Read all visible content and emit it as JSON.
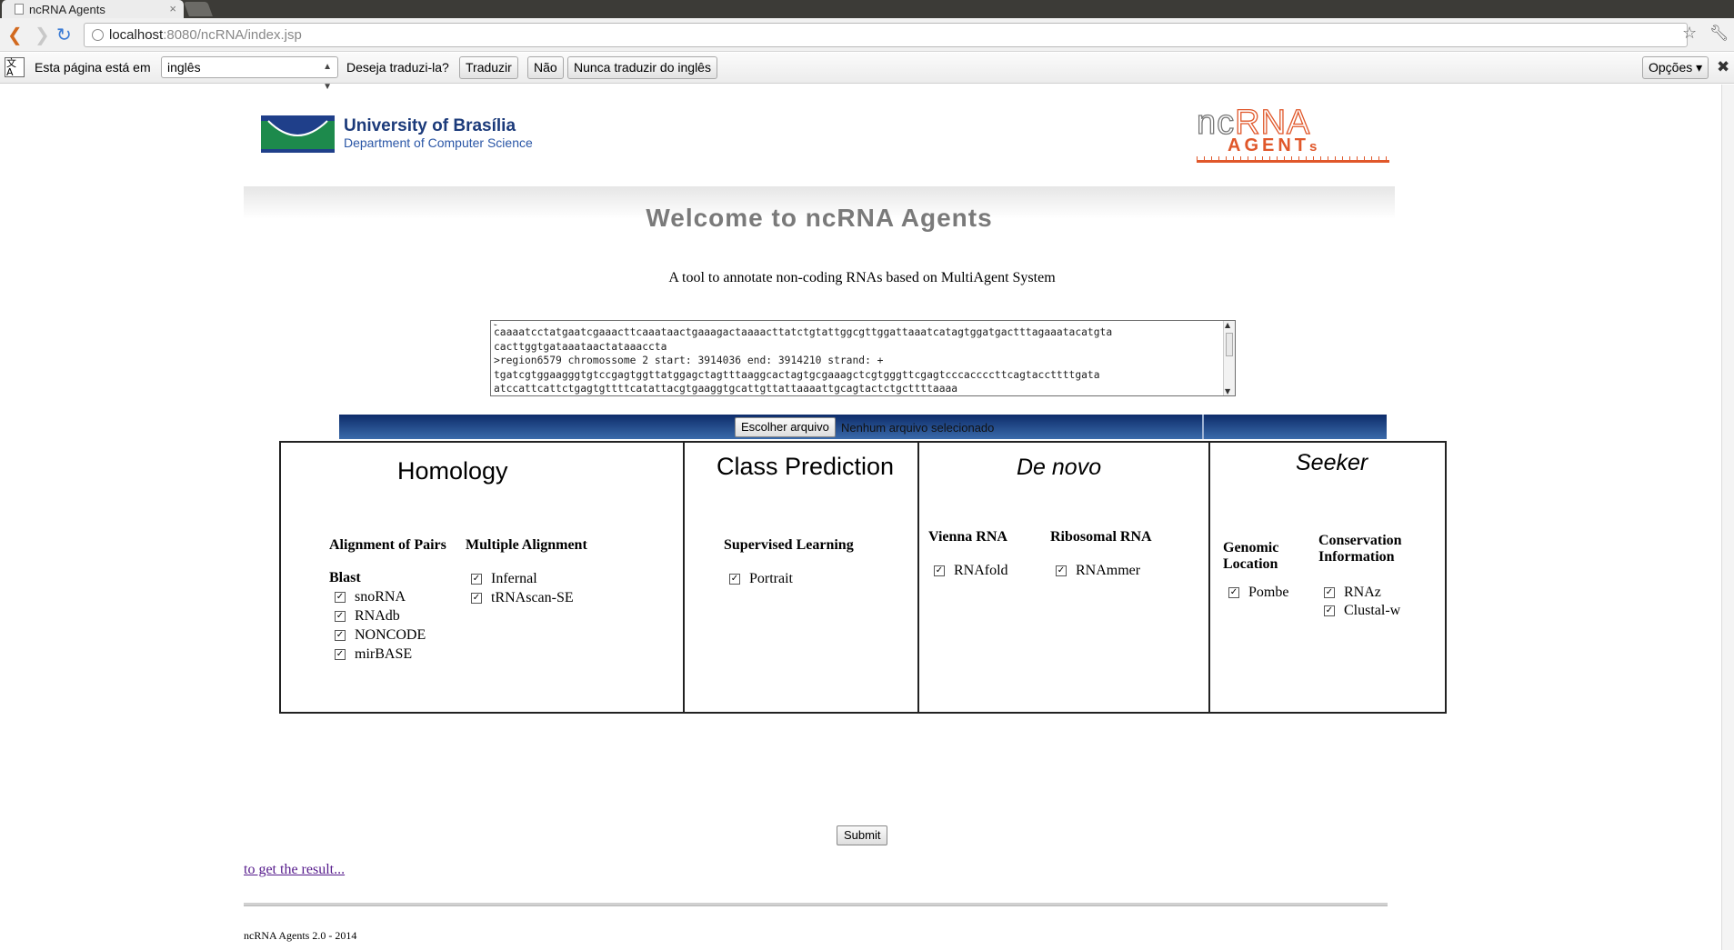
{
  "browser": {
    "tab_title": "ncRNA Agents",
    "tab_close": "×",
    "url_host": "localhost",
    "url_rest": ":8080/ncRNA/index.jsp"
  },
  "translate_bar": {
    "page_language_label": "Esta página está em",
    "language_value": "inglês",
    "question": "Deseja traduzi-la?",
    "translate_button": "Traduzir",
    "no_button": "Não",
    "never_button": "Nunca traduzir do inglês",
    "options_button": "Opções ▾"
  },
  "header": {
    "university_name": "University of Brasília",
    "department": "Department of Computer Science",
    "logo_top_left": "nc",
    "logo_top_right": "RNA",
    "logo_bottom": "AGENT",
    "logo_bottom_suffix": "s"
  },
  "welcome_title": "Welcome to  ncRNA Agents",
  "subtitle": "A tool to annotate non-coding RNAs based on MultiAgent System",
  "sequence_lines": [
    "caaaatcctatgaatcgaaacttcaaataactgaaagactaaaacttatctgtattggcgttggattaaatcatagtggatgactttagaaatacatgta",
    "cacttggtgataaataactataaaccta",
    ">region6579 chromossome 2 start: 3914036 end: 3914210 strand: +",
    "tgatcgtggaagggtgtccgagtggttatggagctagtttaaggcactagtgcgaaagctcgtgggttcgagtcccaccccttcagtaccttttgata",
    "atccattcattctgagtgttttcatattacgtgaaggtgcattgttattaaaattgcagtactctgcttttaaaa"
  ],
  "file_input": {
    "button_label": "Escolher arquivo",
    "status": "Nenhum arquivo selecionado"
  },
  "columns": {
    "homology": {
      "title": "Homology",
      "alignment_pairs_heading": "Alignment of Pairs",
      "multiple_alignment_heading": "Multiple Alignment",
      "blast_heading": "Blast",
      "blast_items": [
        {
          "label": "snoRNA",
          "checked": true
        },
        {
          "label": "RNAdb",
          "checked": true
        },
        {
          "label": "NONCODE",
          "checked": true
        },
        {
          "label": "mirBASE",
          "checked": true
        }
      ],
      "multiple_items": [
        {
          "label": "Infernal",
          "checked": true
        },
        {
          "label": "tRNAscan-SE",
          "checked": true
        }
      ]
    },
    "class_prediction": {
      "title": "Class Prediction",
      "heading": "Supervised Learning",
      "items": [
        {
          "label": "Portrait",
          "checked": true
        }
      ]
    },
    "de_novo": {
      "title": "De novo",
      "vienna_heading": "Vienna RNA",
      "ribosomal_heading": "Ribosomal RNA",
      "vienna_items": [
        {
          "label": "RNAfold",
          "checked": true
        }
      ],
      "ribosomal_items": [
        {
          "label": "RNAmmer",
          "checked": true
        }
      ]
    },
    "seeker": {
      "title": "Seeker",
      "genomic_heading_1": "Genomic",
      "genomic_heading_2": "Location",
      "conservation_heading_1": "Conservation",
      "conservation_heading_2": "Information",
      "genomic_items": [
        {
          "label": "Pombe",
          "checked": true
        }
      ],
      "conservation_items": [
        {
          "label": "RNAz",
          "checked": true
        },
        {
          "label": "Clustal-w",
          "checked": true
        }
      ]
    }
  },
  "submit_label": "Submit",
  "result_link": "to get the result...",
  "footer": "ncRNA Agents 2.0 - 2014"
}
